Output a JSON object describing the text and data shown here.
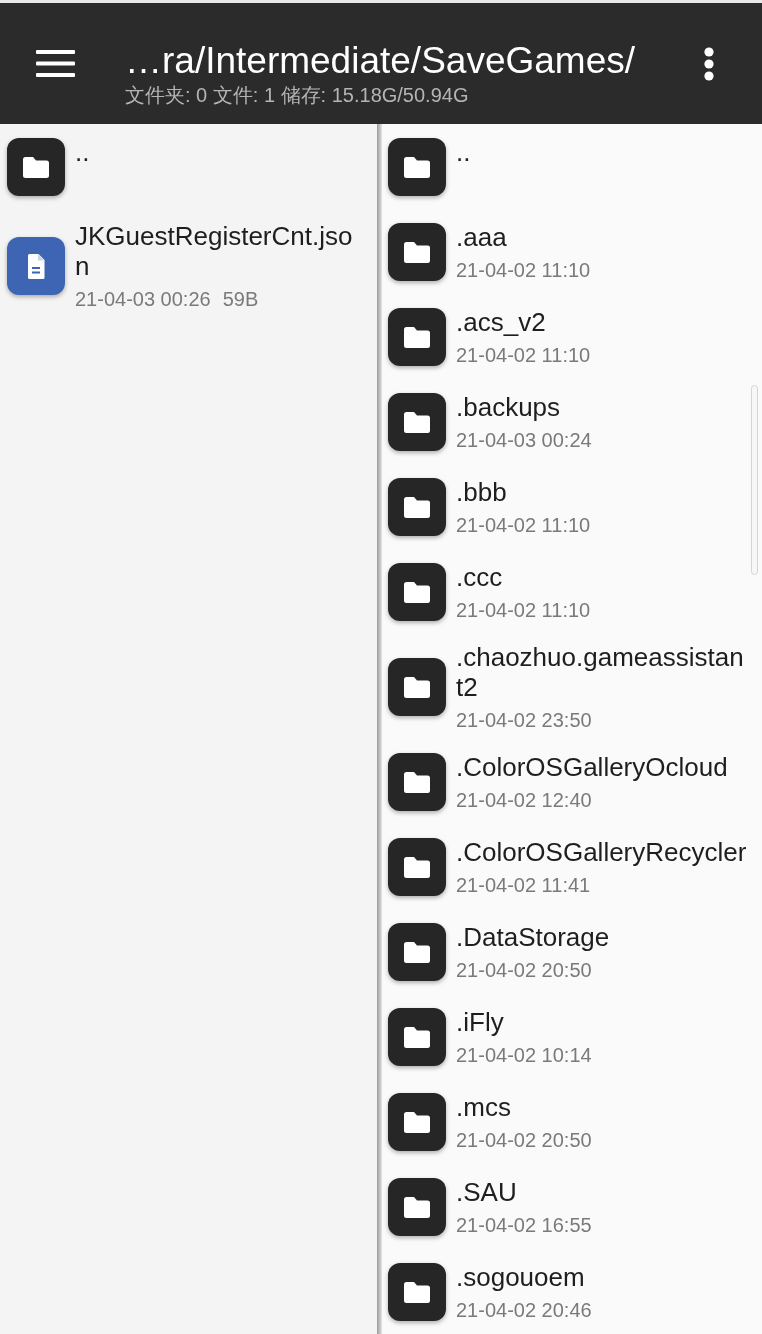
{
  "toolbar": {
    "path": "…ra/Intermediate/SaveGames/",
    "summary": "文件夹: 0 文件: 1 储存: 15.18G/50.94G"
  },
  "panes": [
    {
      "items": [
        {
          "kind": "folder",
          "name": ".."
        },
        {
          "kind": "file",
          "name": "JKGuestRegisterCnt.json",
          "date": "21-04-03 00:26",
          "size": "59B"
        }
      ]
    },
    {
      "items": [
        {
          "kind": "folder",
          "name": ".."
        },
        {
          "kind": "folder",
          "name": ".aaa",
          "date": "21-04-02 11:10"
        },
        {
          "kind": "folder",
          "name": ".acs_v2",
          "date": "21-04-02 11:10"
        },
        {
          "kind": "folder",
          "name": ".backups",
          "date": "21-04-03 00:24"
        },
        {
          "kind": "folder",
          "name": ".bbb",
          "date": "21-04-02 11:10"
        },
        {
          "kind": "folder",
          "name": ".ccc",
          "date": "21-04-02 11:10"
        },
        {
          "kind": "folder",
          "name": ".chaozhuo.gameassistant2",
          "date": "21-04-02 23:50"
        },
        {
          "kind": "folder",
          "name": ".ColorOSGalleryOcloud",
          "date": "21-04-02 12:40"
        },
        {
          "kind": "folder",
          "name": ".ColorOSGalleryRecycler",
          "date": "21-04-02 11:41"
        },
        {
          "kind": "folder",
          "name": ".DataStorage",
          "date": "21-04-02 20:50"
        },
        {
          "kind": "folder",
          "name": ".iFly",
          "date": "21-04-02 10:14"
        },
        {
          "kind": "folder",
          "name": ".mcs",
          "date": "21-04-02 20:50"
        },
        {
          "kind": "folder",
          "name": ".SAU",
          "date": "21-04-02 16:55"
        },
        {
          "kind": "folder",
          "name": ".sogouoem",
          "date": "21-04-02 20:46"
        }
      ]
    }
  ]
}
